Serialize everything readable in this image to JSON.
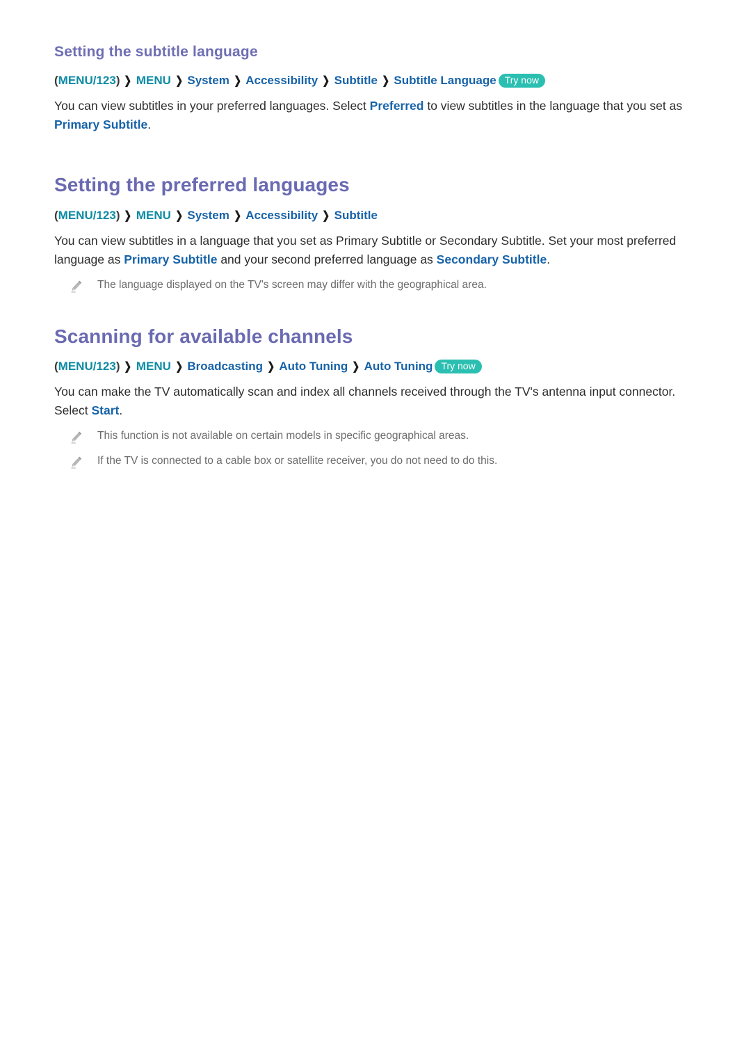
{
  "document": {
    "title": "TV e-Manual page",
    "colors": {
      "heading": "#6a6ab2",
      "link_blue": "#1763a8",
      "menu_teal": "#0d8ca4",
      "trynow_badge": "#2bbfb1",
      "body_text": "#2d2d2d",
      "note_text": "#6b6b6b"
    }
  },
  "sections": [
    {
      "id": "subtitle-language",
      "heading": "Setting the subtitle language",
      "heading_level": "sub",
      "path": {
        "open_paren": "(",
        "menu123": "MENU/123",
        "close_paren": ")",
        "menu": "MENU",
        "chevron": "❯",
        "items": [
          "System",
          "Accessibility",
          "Subtitle",
          "Subtitle Language"
        ],
        "trynow": "Try now"
      },
      "paragraph": {
        "part1": "You can view subtitles in your preferred languages. Select ",
        "link1": "Preferred",
        "part2": " to view subtitles in the language that you set as ",
        "link2": "Primary Subtitle",
        "part3": "."
      },
      "notes": []
    },
    {
      "id": "preferred-languages",
      "heading": "Setting the preferred languages",
      "heading_level": "main",
      "path": {
        "open_paren": "(",
        "menu123": "MENU/123",
        "close_paren": ")",
        "menu": "MENU",
        "chevron": "❯",
        "items": [
          "System",
          "Accessibility",
          "Subtitle"
        ],
        "trynow": ""
      },
      "paragraph": {
        "part1": "You can view subtitles in a language that you set as Primary Subtitle or Secondary Subtitle. Set your most preferred language as ",
        "link1": "Primary Subtitle",
        "part2": " and your second preferred language as ",
        "link2": "Secondary Subtitle",
        "part3": "."
      },
      "notes": [
        "The language displayed on the TV's screen may differ with the geographical area."
      ]
    },
    {
      "id": "scanning-channels",
      "heading": "Scanning for available channels",
      "heading_level": "main",
      "path": {
        "open_paren": "(",
        "menu123": "MENU/123",
        "close_paren": ")",
        "menu": "MENU",
        "chevron": "❯",
        "items": [
          "Broadcasting",
          "Auto Tuning",
          "Auto Tuning"
        ],
        "trynow": "Try now"
      },
      "paragraph": {
        "part1": "You can make the TV automatically scan and index all channels received through the TV's antenna input connector. Select ",
        "link1": "Start",
        "part2": ".",
        "link2": "",
        "part3": ""
      },
      "notes": [
        "This function is not available on certain models in specific geographical areas.",
        "If the TV is connected to a cable box or satellite receiver, you do not need to do this."
      ]
    }
  ],
  "icons": {
    "note": "pencil-icon"
  }
}
